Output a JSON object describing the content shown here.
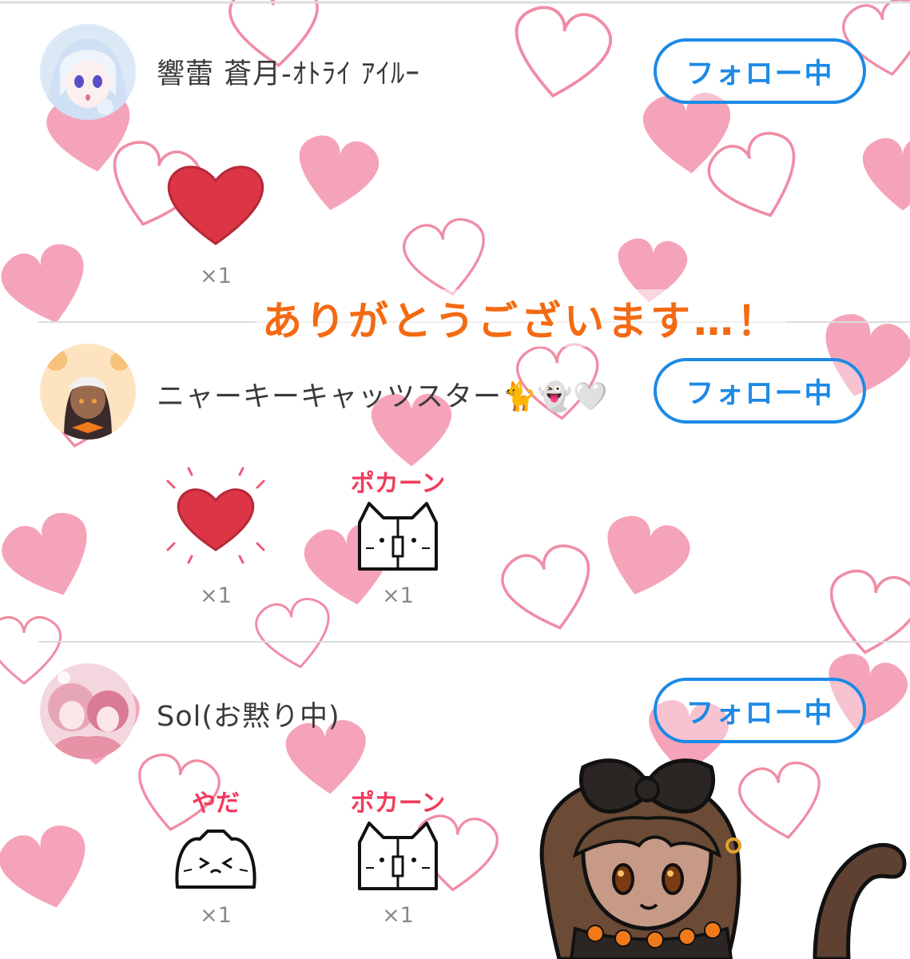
{
  "users": [
    {
      "name": "響蕾 蒼月-ｵﾄﾗｲ ｱｲﾙｰ",
      "follow_label": "フォロー中",
      "reactions": [
        {
          "icon": "heart-icon",
          "count": "×1"
        }
      ]
    },
    {
      "name": "ニャーキーキャッツスター🐈👻🤍",
      "follow_label": "フォロー中",
      "reactions": [
        {
          "icon": "sparkle-heart-icon",
          "count": "×1"
        },
        {
          "icon": "cat-bonk-icon",
          "label": "ポカーン",
          "count": "×1"
        }
      ]
    },
    {
      "name": "Sol(お黙り中)",
      "follow_label": "フォロー中",
      "reactions": [
        {
          "icon": "cat-upset-icon",
          "label": "やだ",
          "count": "×1"
        },
        {
          "icon": "cat-bonk-icon",
          "label": "ポカーン",
          "count": "×1"
        }
      ]
    }
  ],
  "overlay_text": "ありがとうございます…！",
  "colors": {
    "follow_accent": "#1c8ae6",
    "heart_red": "#dc3545",
    "reaction_label": "#f03c5c",
    "overlay_text": "#f36a12",
    "bg_heart_pink": "#f5a3b8"
  }
}
